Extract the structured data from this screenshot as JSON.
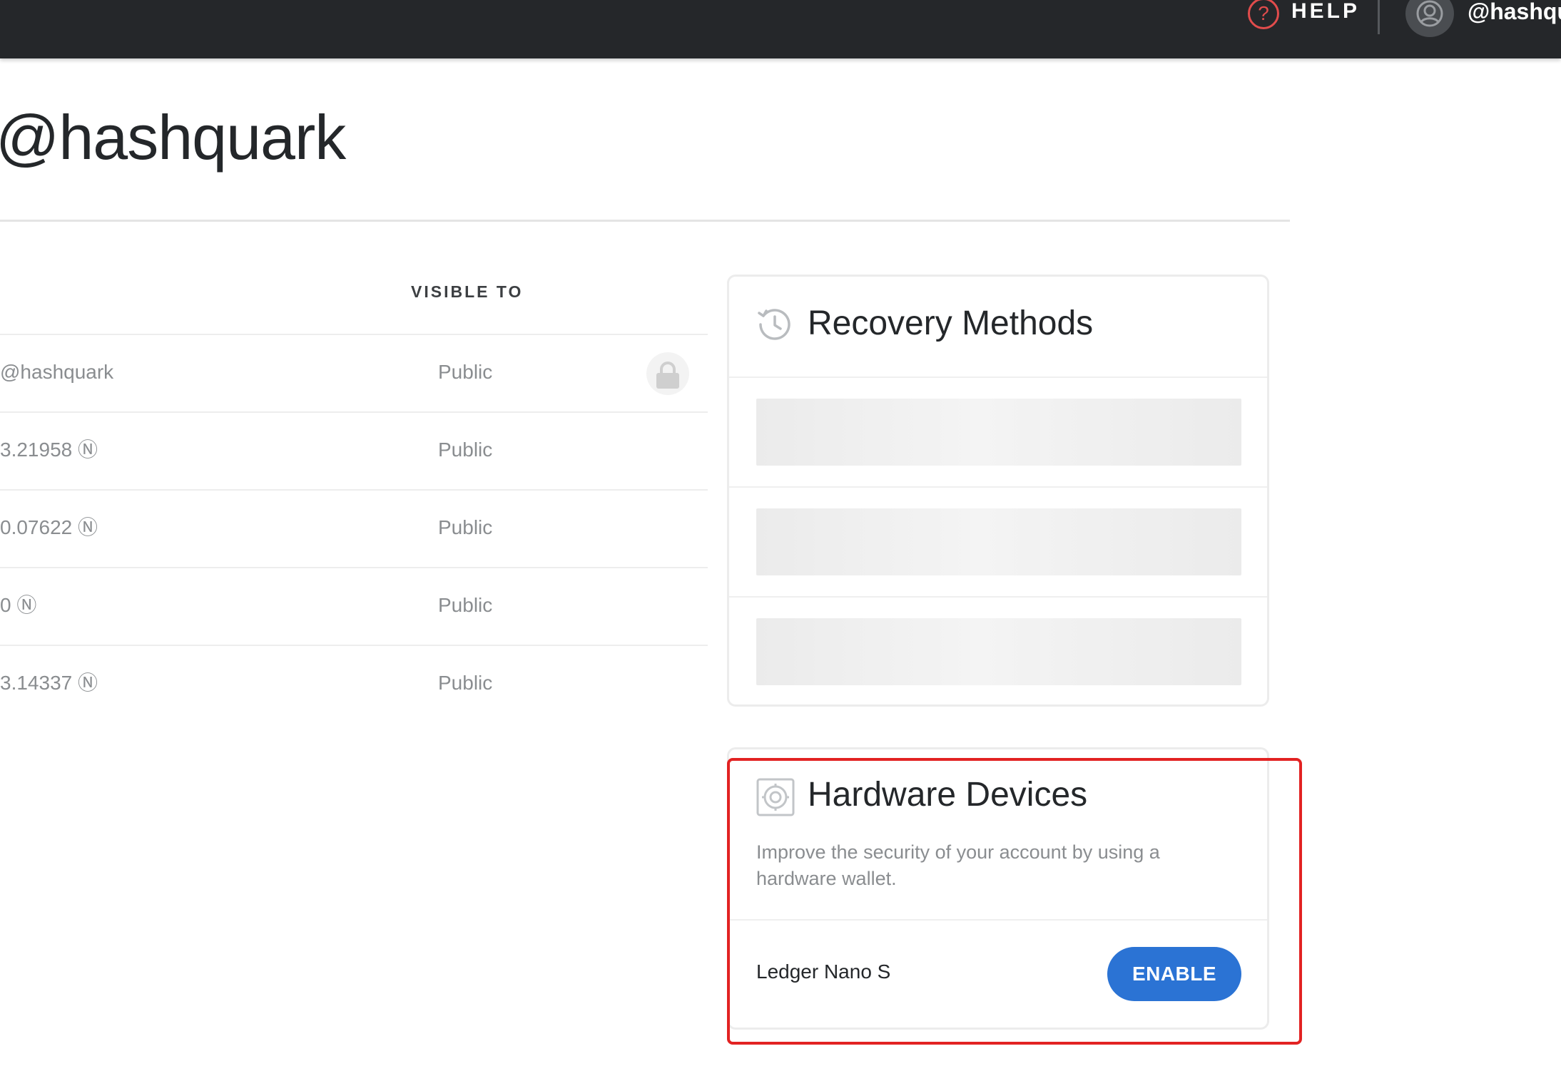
{
  "topbar": {
    "help_icon": "question-mark",
    "help_icon_glyph": "?",
    "help_label": "HELP",
    "account_name": "@hashqu",
    "avatar_icon": "user-circle"
  },
  "page": {
    "title": "@hashquark"
  },
  "table": {
    "column_visible_to": "VISIBLE TO",
    "rows": [
      {
        "value": "@hashquark",
        "visibility": "Public"
      },
      {
        "value": "3.21958 Ⓝ",
        "visibility": "Public"
      },
      {
        "value": "0.07622 Ⓝ",
        "visibility": "Public"
      },
      {
        "value": "0 Ⓝ",
        "visibility": "Public"
      },
      {
        "value": "3.14337 Ⓝ",
        "visibility": "Public"
      }
    ],
    "lock_icon": "lock"
  },
  "recovery": {
    "title": "Recovery Methods",
    "icon": "history-clock"
  },
  "hardware": {
    "title": "Hardware Devices",
    "icon": "hardware-device",
    "description": "Improve the security of your account by using a hardware wallet.",
    "device_name": "Ledger Nano S",
    "enable_label": "ENABLE"
  },
  "colors": {
    "topbar": "#25272a",
    "accent_blue": "#2b73d4",
    "help_red": "#e14c4c",
    "highlight_red": "#e22222"
  }
}
